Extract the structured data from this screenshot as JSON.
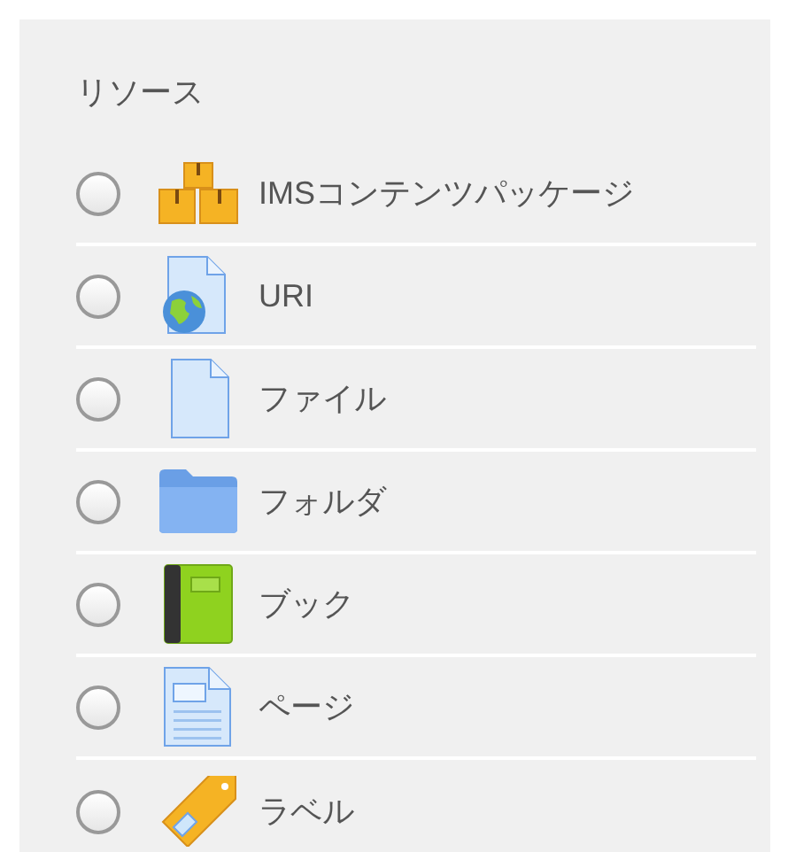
{
  "section": {
    "title": "リソース"
  },
  "items": [
    {
      "kind": "package",
      "label": "IMSコンテンツパッケージ",
      "selected": false
    },
    {
      "kind": "url",
      "label": "URI",
      "selected": false
    },
    {
      "kind": "file",
      "label": "ファイル",
      "selected": false
    },
    {
      "kind": "folder",
      "label": "フォルダ",
      "selected": false
    },
    {
      "kind": "book",
      "label": "ブック",
      "selected": false
    },
    {
      "kind": "page",
      "label": "ページ",
      "selected": false
    },
    {
      "kind": "label",
      "label": "ラベル",
      "selected": false
    }
  ]
}
